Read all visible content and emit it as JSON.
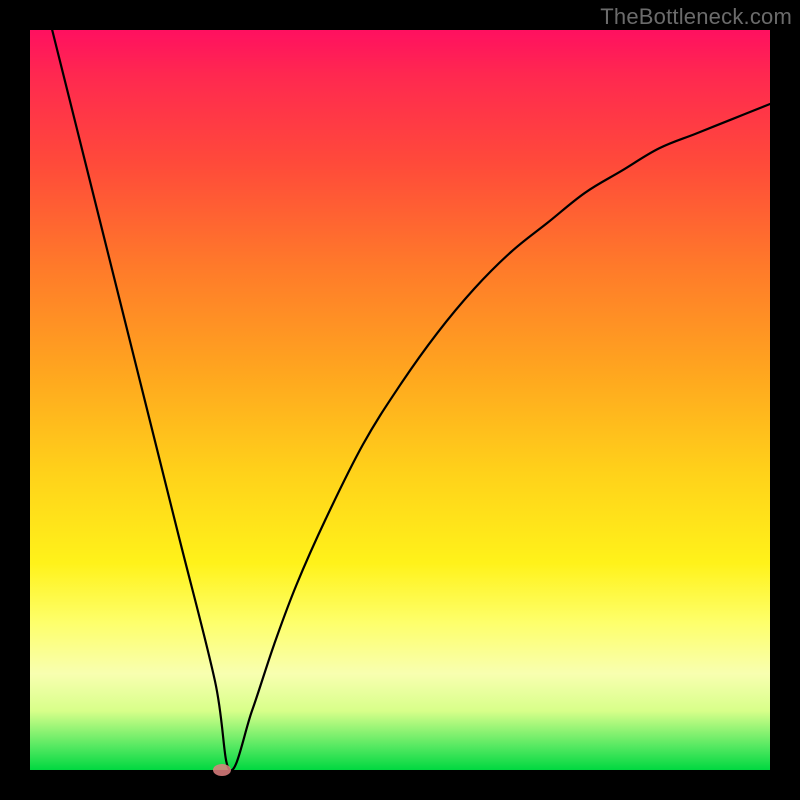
{
  "watermark": "TheBottleneck.com",
  "colors": {
    "frame": "#000000",
    "gradient_stops": [
      "#ff1060",
      "#ff2850",
      "#ff4a3a",
      "#ff7a2a",
      "#ffa51f",
      "#ffd21a",
      "#fff21a",
      "#feff6a",
      "#f8ffb0",
      "#d8ff8a",
      "#50e860",
      "#00d840"
    ],
    "curve": "#000000",
    "marker": "#e08080"
  },
  "chart_data": {
    "type": "line",
    "title": "",
    "xlabel": "",
    "ylabel": "",
    "xlim": [
      0,
      100
    ],
    "ylim": [
      0,
      100
    ],
    "grid": false,
    "legend": false,
    "annotations": [
      {
        "kind": "marker",
        "x": 26,
        "y": 0
      }
    ],
    "series": [
      {
        "name": "curve",
        "description": "V-shaped curve with steep linear left arm descending from top and asymptotic right arm rising toward top-right",
        "x": [
          0,
          5,
          10,
          15,
          20,
          25,
          27,
          30,
          33,
          36,
          40,
          45,
          50,
          55,
          60,
          65,
          70,
          75,
          80,
          85,
          90,
          95,
          100
        ],
        "y": [
          112,
          92,
          72,
          52,
          32,
          12,
          0,
          8,
          17,
          25,
          34,
          44,
          52,
          59,
          65,
          70,
          74,
          78,
          81,
          84,
          86,
          88,
          90
        ]
      }
    ]
  }
}
